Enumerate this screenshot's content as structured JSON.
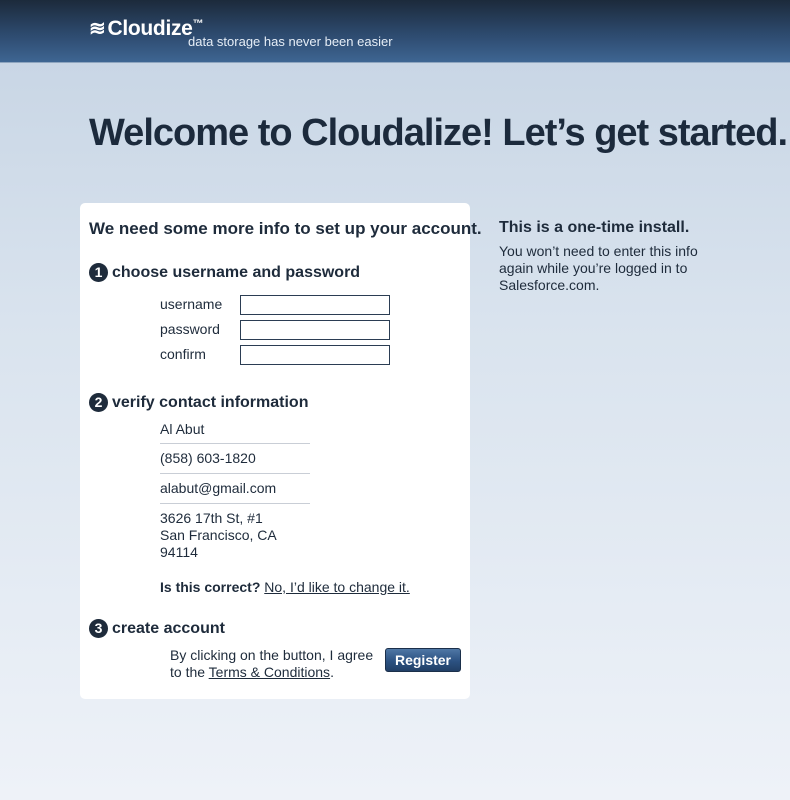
{
  "header": {
    "logo_waves": "≋",
    "logo_text": "Cloudize",
    "logo_tm": "™",
    "tagline": "data storage has never been easier"
  },
  "headline": "Welcome to Cloudalize! Let’s get started.",
  "card": {
    "title": "We need some more info to set up your account.",
    "step1": {
      "number": "1",
      "label": "choose username and password",
      "fields": [
        {
          "label": "username",
          "value": ""
        },
        {
          "label": "password",
          "value": ""
        },
        {
          "label": "confirm",
          "value": ""
        }
      ]
    },
    "step2": {
      "number": "2",
      "label": "verify contact information",
      "name": "Al Abut",
      "phone": "(858) 603-1820",
      "email": "alabut@gmail.com",
      "address": {
        "line1": "3626 17th St, #1",
        "line2": "San Francisco, CA",
        "line3": "94114"
      },
      "correct_question": "Is this correct?",
      "change_link": "No, I’d like to change it."
    },
    "step3": {
      "number": "3",
      "label": "create account",
      "agree_text": "By clicking on the button, I agree to the",
      "terms_link": "Terms & Conditions",
      "terms_suffix": ".",
      "register_label": "Register"
    }
  },
  "side": {
    "title": "This is a one-time install.",
    "text": "You won’t need to enter this info again while you’re logged in to Salesforce.com."
  }
}
